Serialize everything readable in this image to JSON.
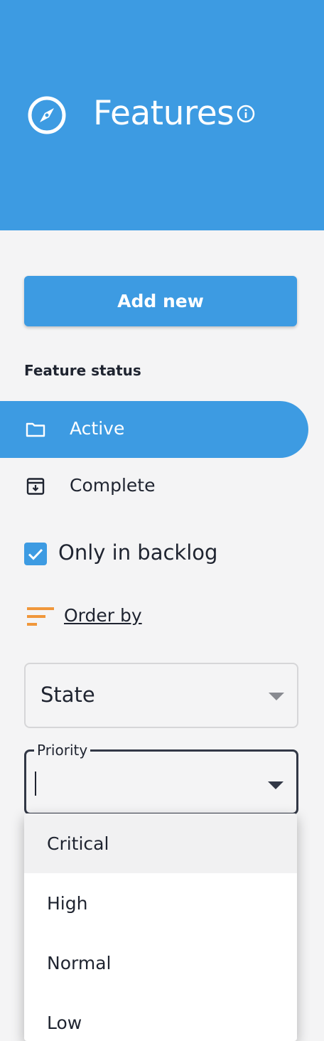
{
  "header": {
    "title": "Features",
    "icon": "compass-icon",
    "info_icon": "info-icon",
    "color": "#3d9be2"
  },
  "add_button": {
    "label": "Add new"
  },
  "feature_status": {
    "label": "Feature status",
    "items": [
      {
        "label": "Active",
        "icon": "folder-icon",
        "active": true
      },
      {
        "label": "Complete",
        "icon": "archive-icon",
        "active": false
      }
    ]
  },
  "backlog_checkbox": {
    "label": "Only in backlog",
    "checked": true
  },
  "order_by": {
    "label": "Order by",
    "icon": "sort-icon",
    "icon_color": "#f0973b"
  },
  "state_select": {
    "value": "State"
  },
  "priority_select": {
    "label": "Priority",
    "value": "",
    "options": [
      "Critical",
      "High",
      "Normal",
      "Low"
    ],
    "highlighted": "Critical"
  }
}
